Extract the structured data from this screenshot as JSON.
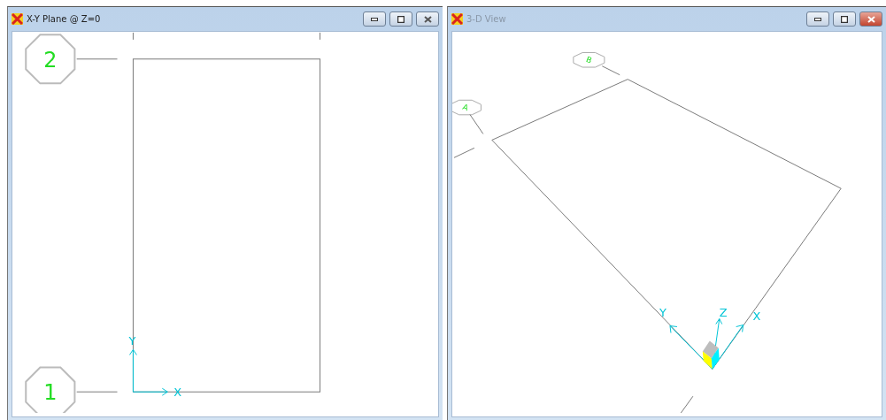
{
  "windows": [
    {
      "title": "X-Y Plane @ Z=0",
      "active": false,
      "kind": "plan",
      "grid_bubbles": [
        "2",
        "1"
      ],
      "axes": [
        "X",
        "Y"
      ]
    },
    {
      "title": "3-D View",
      "active": true,
      "kind": "perspective",
      "grid_bubbles": [
        "B",
        "A"
      ],
      "axes": [
        "Y",
        "Z",
        "X"
      ]
    }
  ]
}
